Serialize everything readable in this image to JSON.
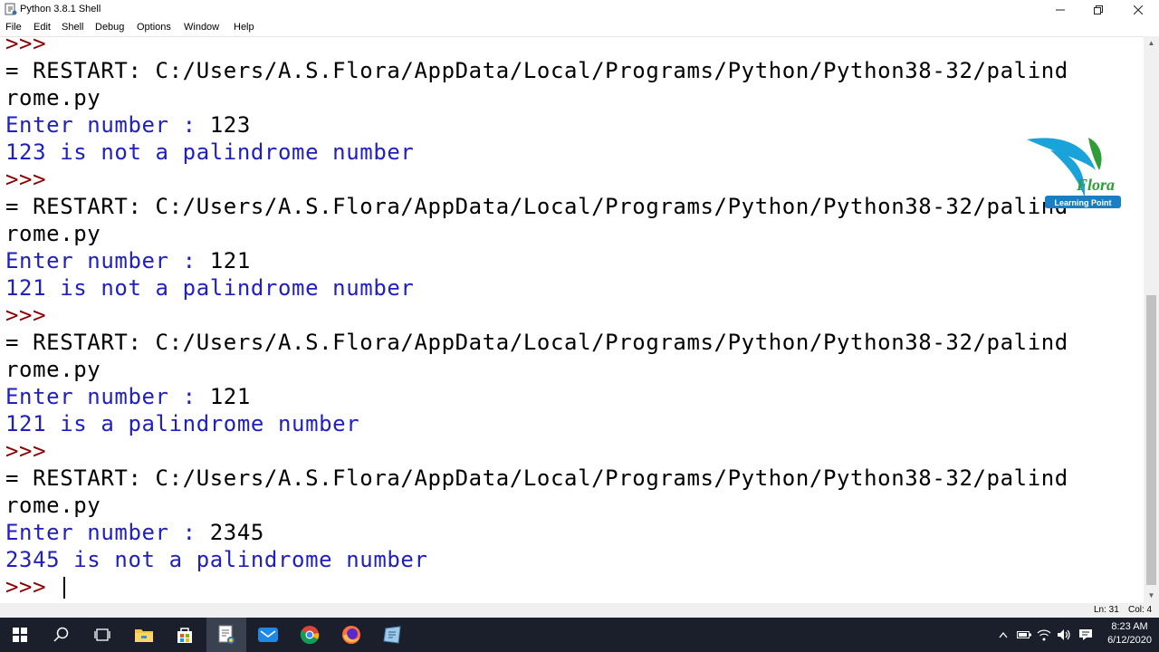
{
  "window": {
    "title": "Python 3.8.1 Shell",
    "minimize_icon": "minimize-icon",
    "maximize_icon": "restore-icon",
    "close_icon": "close-icon"
  },
  "menu": [
    "File",
    "Edit",
    "Shell",
    "Debug",
    "Options",
    "Window",
    "Help"
  ],
  "shell_lines": [
    {
      "kind": "prompt",
      "text": ">>>"
    },
    {
      "kind": "restart",
      "text": "= RESTART: C:/Users/A.S.Flora/AppData/Local/Programs/Python/Python38-32/palind"
    },
    {
      "kind": "restart",
      "text": "rome.py"
    },
    {
      "kind": "input",
      "label": "Enter number : ",
      "value": "123"
    },
    {
      "kind": "out",
      "text": "123 is not a palindrome number"
    },
    {
      "kind": "prompt",
      "text": ">>>"
    },
    {
      "kind": "restart",
      "text": "= RESTART: C:/Users/A.S.Flora/AppData/Local/Programs/Python/Python38-32/palind"
    },
    {
      "kind": "restart",
      "text": "rome.py"
    },
    {
      "kind": "input",
      "label": "Enter number : ",
      "value": "121"
    },
    {
      "kind": "out",
      "text": "121 is not a palindrome number"
    },
    {
      "kind": "prompt",
      "text": ">>>"
    },
    {
      "kind": "restart",
      "text": "= RESTART: C:/Users/A.S.Flora/AppData/Local/Programs/Python/Python38-32/palind"
    },
    {
      "kind": "restart",
      "text": "rome.py"
    },
    {
      "kind": "input",
      "label": "Enter number : ",
      "value": "121"
    },
    {
      "kind": "out",
      "text": "121 is a palindrome number"
    },
    {
      "kind": "prompt",
      "text": ">>>"
    },
    {
      "kind": "restart",
      "text": "= RESTART: C:/Users/A.S.Flora/AppData/Local/Programs/Python/Python38-32/palind"
    },
    {
      "kind": "restart",
      "text": "rome.py"
    },
    {
      "kind": "input",
      "label": "Enter number : ",
      "value": "2345"
    },
    {
      "kind": "out",
      "text": "2345 is not a palindrome number"
    },
    {
      "kind": "prompt_cursor",
      "text": ">>> "
    }
  ],
  "status": {
    "line": "Ln: 31",
    "col": "Col: 4"
  },
  "watermark": {
    "brand": "Flora",
    "tagline": "Learning Point"
  },
  "taskbar": {
    "apps": [
      "start-icon",
      "search-icon",
      "task-view-icon",
      "file-explorer-icon",
      "store-icon",
      "idle-editor-icon",
      "mail-icon",
      "chrome-icon",
      "firefox-icon",
      "python-icon"
    ],
    "tray": [
      "chevron-up-icon",
      "battery-icon",
      "wifi-icon",
      "volume-icon",
      "notification-icon"
    ],
    "time": "8:23 AM",
    "date": "6/12/2020"
  },
  "colors": {
    "prompt": "#8b0000",
    "output": "#2020c0",
    "text": "#000000",
    "taskbar": "#1a1f2b"
  }
}
